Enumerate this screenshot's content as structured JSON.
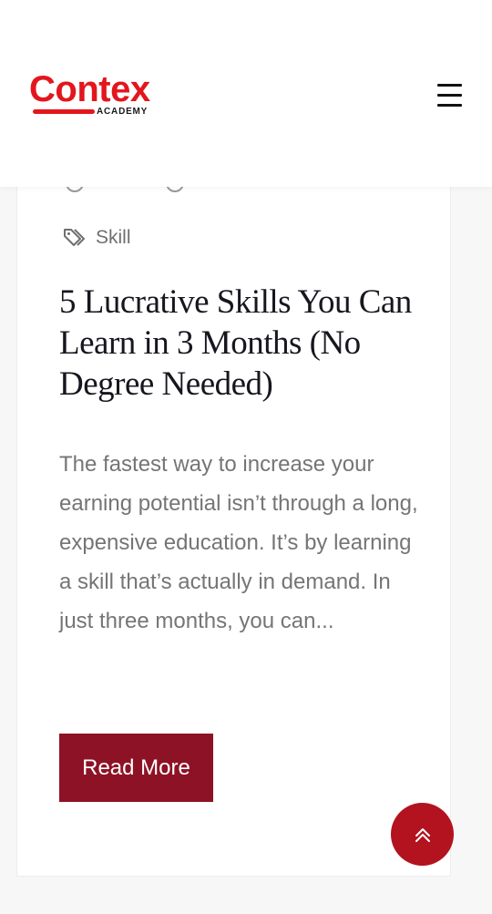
{
  "header": {
    "logo_text": "Contex",
    "logo_subtext": "ACADEMY",
    "menu_icon": "hamburger-icon"
  },
  "post": {
    "meta_author_icon": "user-icon",
    "meta_date_icon": "calendar-icon",
    "tag_icon": "tag-icon",
    "tag": "Skill",
    "title": "5 Lucrative Skills You Can Learn in 3 Months (No Degree Needed)",
    "excerpt": "The fastest way to increase your earning potential isn’t through a long, expensive education. It’s by learning a skill that’s actually in demand. In just three months, you can...",
    "read_more_label": "Read More"
  },
  "scroll_top": {
    "icon": "double-chevron-up-icon"
  },
  "colors": {
    "brand_red": "#e3161d",
    "button_maroon": "#8e1226",
    "scroll_top_red": "#b3121f"
  }
}
